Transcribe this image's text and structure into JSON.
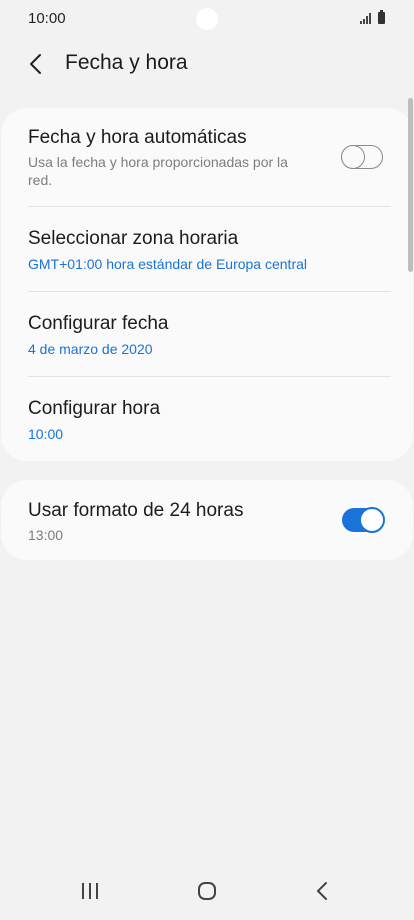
{
  "status_bar": {
    "time": "10:00",
    "signal_icon": "signal-icon",
    "battery_icon": "battery-icon"
  },
  "header": {
    "back_icon": "chevron-left-icon",
    "title": "Fecha y hora"
  },
  "settings": {
    "automatic": {
      "title": "Fecha y hora automáticas",
      "subtitle_line1": "Usa la fecha y hora proporcionadas por la",
      "subtitle_line2": "red.",
      "enabled": false
    },
    "timezone": {
      "title": "Seleccionar zona horaria",
      "value": "GMT+01:00 hora estándar de Europa central"
    },
    "date": {
      "title": "Configurar fecha",
      "value": "4 de marzo de 2020"
    },
    "time": {
      "title": "Configurar hora",
      "value": "10:00"
    },
    "format24": {
      "title": "Usar formato de 24 horas",
      "value": "13:00",
      "enabled": true
    }
  },
  "nav_bar": {
    "recents_icon": "recent-apps-icon",
    "home_icon": "home-icon",
    "back_icon": "back-icon"
  },
  "colors": {
    "accent": "#1a73d8",
    "background": "#f2f2f2",
    "card": "#fafafa"
  }
}
